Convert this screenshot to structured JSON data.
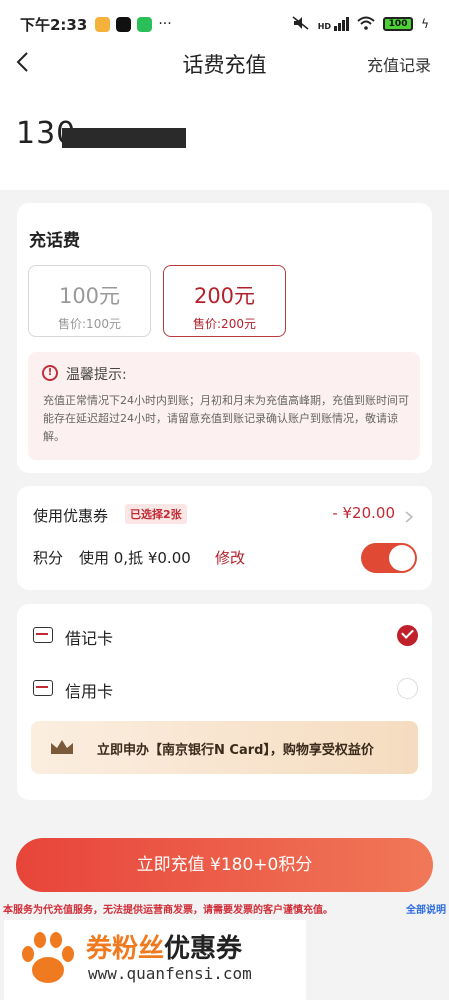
{
  "status_bar": {
    "time": "下午2:33",
    "network_label": "HD",
    "battery": "100"
  },
  "header": {
    "title": "话费充值",
    "right_link": "充值记录"
  },
  "phone": {
    "number_visible": "130"
  },
  "recharge": {
    "title": "充话费",
    "options": [
      {
        "amount": "100元",
        "price": "售价:100元",
        "selected": false
      },
      {
        "amount": "200元",
        "price": "售价:200元",
        "selected": true
      }
    ],
    "tip": {
      "title": "温馨提示:",
      "text": "充值正常情况下24小时内到账；月初和月末为充值高峰期，充值到账时间可能存在延迟超过24小时，请留意充值到账记录确认账户到账情况，敬请谅解。"
    }
  },
  "discount": {
    "coupon_label": "使用优惠券",
    "coupon_badge": "已选择2张",
    "coupon_amount": "- ¥20.00",
    "points_label": "积分",
    "points_desc": "使用 0,抵 ¥0.00",
    "points_modify": "修改",
    "points_toggle_on": true
  },
  "payment": {
    "methods": [
      {
        "label": "借记卡",
        "selected": true
      },
      {
        "label": "信用卡",
        "selected": false
      }
    ],
    "promo": "立即申办【南京银行N Card】，购物享受权益价"
  },
  "submit": {
    "label": "立即充值 ¥180+0积分"
  },
  "footer": {
    "disclaimer": "本服务为代充值服务，无法提供运营商发票，请需要发票的客户谨慎充值。",
    "link": "全部说明"
  },
  "watermark": {
    "title_a": "券粉丝",
    "title_b": "优惠券",
    "url": "www.quanfensi.com"
  },
  "colors": {
    "accent": "#c0202a",
    "button_gradient_start": "#e8443a",
    "button_gradient_end": "#f07858"
  }
}
